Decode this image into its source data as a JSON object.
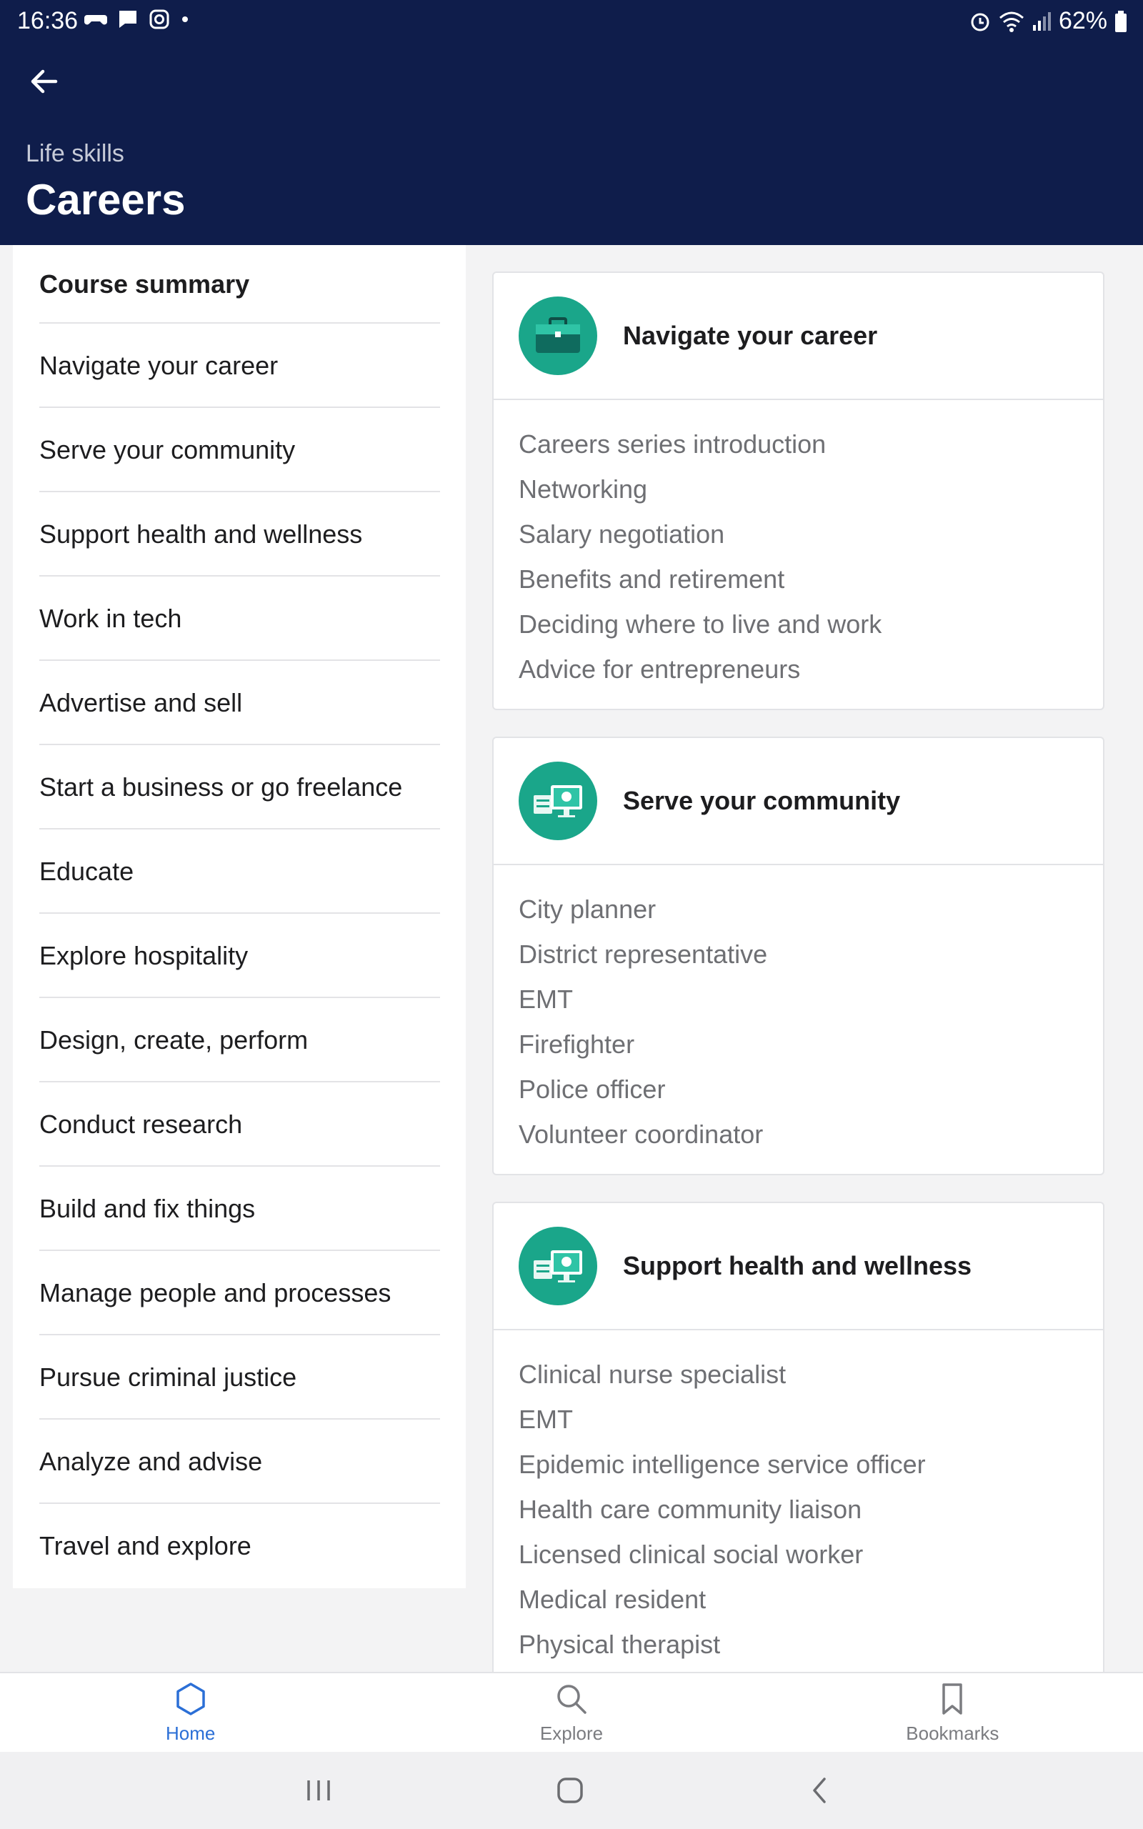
{
  "status_bar": {
    "time": "16:36",
    "battery": "62%"
  },
  "header": {
    "subtitle": "Life skills",
    "title": "Careers"
  },
  "sidebar": {
    "items": [
      {
        "label": "Course summary"
      },
      {
        "label": "Navigate your career"
      },
      {
        "label": "Serve your community"
      },
      {
        "label": "Support health and wellness"
      },
      {
        "label": "Work in tech"
      },
      {
        "label": "Advertise and sell"
      },
      {
        "label": "Start a business or go freelance"
      },
      {
        "label": "Educate"
      },
      {
        "label": "Explore hospitality"
      },
      {
        "label": "Design, create, perform"
      },
      {
        "label": "Conduct research"
      },
      {
        "label": "Build and fix things"
      },
      {
        "label": "Manage people and processes"
      },
      {
        "label": "Pursue criminal justice"
      },
      {
        "label": "Analyze and advise"
      },
      {
        "label": "Travel and explore"
      }
    ]
  },
  "cards": [
    {
      "title": "Navigate your career",
      "icon": "briefcase-icon",
      "items": [
        "Careers series introduction",
        "Networking",
        "Salary negotiation",
        "Benefits and retirement",
        "Deciding where to live and work",
        "Advice for entrepreneurs"
      ]
    },
    {
      "title": "Serve your community",
      "icon": "monitor-icon",
      "items": [
        "City planner",
        "District representative",
        "EMT",
        "Firefighter",
        "Police officer",
        "Volunteer coordinator"
      ]
    },
    {
      "title": "Support health and wellness",
      "icon": "monitor-icon",
      "items": [
        "Clinical nurse specialist",
        "EMT",
        "Epidemic intelligence service officer",
        "Health care community liaison",
        "Licensed clinical social worker",
        "Medical resident",
        "Physical therapist"
      ]
    }
  ],
  "bottom_nav": {
    "home": "Home",
    "explore": "Explore",
    "bookmarks": "Bookmarks"
  },
  "colors": {
    "header_bg": "#0f1d4b",
    "accent": "#2b6fd6",
    "icon_bg": "#1aa68a"
  }
}
